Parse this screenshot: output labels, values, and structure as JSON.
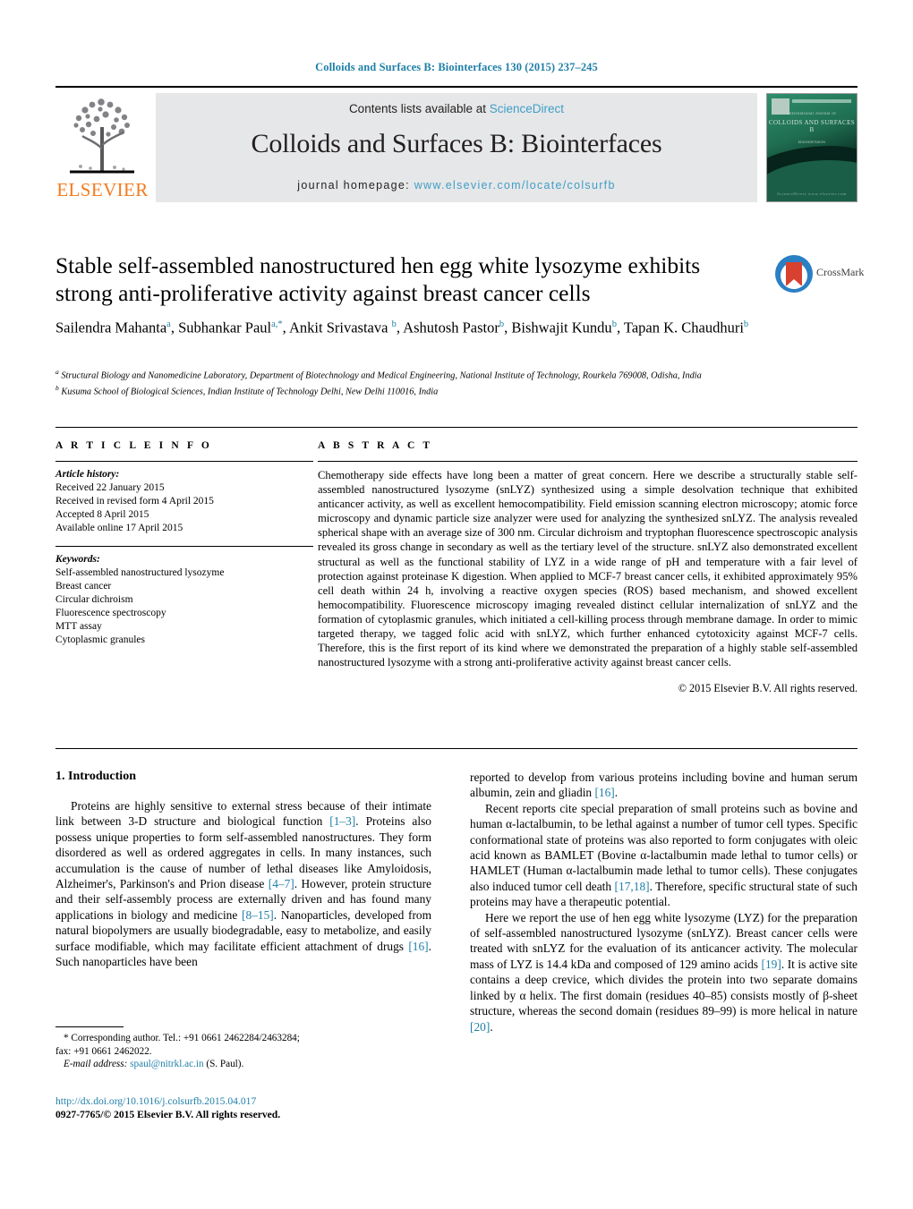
{
  "running_head": "Colloids and Surfaces B: Biointerfaces 130 (2015) 237–245",
  "masthead": {
    "contents_prefix": "Contents lists available at ",
    "contents_link": "ScienceDirect",
    "journal_name": "Colloids and Surfaces B: Biointerfaces",
    "homepage_prefix": "journal homepage: ",
    "homepage_url": "www.elsevier.com/locate/colsurfb",
    "publisher": "ELSEVIER",
    "cover": {
      "title": "COLLOIDS AND SURFACES B",
      "kicker": "International Journal of",
      "subtitle": "Biointerfaces",
      "footer": "ScienceDirect  www.elsevier.com"
    }
  },
  "article": {
    "title": "Stable self-assembled nanostructured hen egg white lysozyme exhibits strong anti-proliferative activity against breast cancer cells",
    "crossmark_label": "CrossMark",
    "authors_line1": "Sailendra Mahanta",
    "authors_html": "Sailendra Mahanta<sup>a</sup>, Subhankar Paul<sup>a,*</sup>, Ankit Srivastava <sup>b</sup>, Ashutosh Pastor<sup>b</sup>, Bishwajit Kundu<sup>b</sup>, Tapan K. Chaudhuri<sup>b</sup>",
    "affiliations": [
      "a Structural Biology and Nanomedicine Laboratory, Department of Biotechnology and Medical Engineering, National Institute of Technology, Rourkela 769008, Odisha, India",
      "b Kusuma School of Biological Sciences, Indian Institute of Technology Delhi, New Delhi 110016, India"
    ]
  },
  "article_info": {
    "heading": "A R T I C L E  I N F O",
    "history_label": "Article history:",
    "history": [
      "Received 22 January 2015",
      "Received in revised form 4 April 2015",
      "Accepted 8 April 2015",
      "Available online 17 April 2015"
    ],
    "keywords_label": "Keywords:",
    "keywords": [
      "Self-assembled nanostructured lysozyme",
      "Breast cancer",
      "Circular dichroism",
      "Fluorescence spectroscopy",
      "MTT assay",
      "Cytoplasmic granules"
    ]
  },
  "abstract": {
    "heading": "A B S T R A C T",
    "text": "Chemotherapy side effects have long been a matter of great concern. Here we describe a structurally stable self-assembled nanostructured lysozyme (snLYZ) synthesized using a simple desolvation technique that exhibited anticancer activity, as well as excellent hemocompatibility. Field emission scanning electron microscopy; atomic force microscopy and dynamic particle size analyzer were used for analyzing the synthesized snLYZ. The analysis revealed spherical shape with an average size of 300 nm. Circular dichroism and tryptophan fluorescence spectroscopic analysis revealed its gross change in secondary as well as the tertiary level of the structure. snLYZ also demonstrated excellent structural as well as the functional stability of LYZ in a wide range of pH and temperature with a fair level of protection against proteinase K digestion. When applied to MCF-7 breast cancer cells, it exhibited approximately 95% cell death within 24 h, involving a reactive oxygen species (ROS) based mechanism, and showed excellent hemocompatibility. Fluorescence microscopy imaging revealed distinct cellular internalization of snLYZ and the formation of cytoplasmic granules, which initiated a cell-killing process through membrane damage. In order to mimic targeted therapy, we tagged folic acid with snLYZ, which further enhanced cytotoxicity against MCF-7 cells. Therefore, this is the first report of its kind where we demonstrated the preparation of a highly stable self-assembled nanostructured lysozyme with a strong anti-proliferative activity against breast cancer cells.",
    "copyright": "© 2015 Elsevier B.V. All rights reserved."
  },
  "introduction": {
    "heading": "1. Introduction",
    "left_paragraph_html": "Proteins are highly sensitive to external stress because of their intimate link between 3-D structure and biological function <span class=\"ref\">[1–3]</span>. Proteins also possess unique properties to form self-assembled nanostructures. They form disordered as well as ordered aggregates in cells. In many instances, such accumulation is the cause of number of lethal diseases like Amyloidosis, Alzheimer's, Parkinson's and Prion disease <span class=\"ref\">[4–7]</span>. However, protein structure and their self-assembly process are externally driven and has found many applications in biology and medicine <span class=\"ref\">[8–15]</span>. Nanoparticles, developed from natural biopolymers are usually biodegradable, easy to metabolize, and easily surface modifiable, which may facilitate efficient attachment of drugs <span class=\"ref\">[16]</span>. Such nanoparticles have been",
    "right_paragraph1_html": "reported to develop from various proteins including bovine and human serum albumin, zein and gliadin <span class=\"ref\">[16]</span>.",
    "right_paragraph2_html": "Recent reports cite special preparation of small proteins such as bovine and human α-lactalbumin, to be lethal against a number of tumor cell types. Specific conformational state of proteins was also reported to form conjugates with oleic acid known as BAMLET (Bovine α-lactalbumin made lethal to tumor cells) or HAMLET (Human α-lactalbumin made lethal to tumor cells). These conjugates also induced tumor cell death <span class=\"ref\">[17,18]</span>. Therefore, specific structural state of such proteins may have a therapeutic potential.",
    "right_paragraph3_html": "Here we report the use of hen egg white lysozyme (LYZ) for the preparation of self-assembled nanostructured lysozyme (snLYZ). Breast cancer cells were treated with snLYZ for the evaluation of its anticancer activity. The molecular mass of LYZ is 14.4 kDa and composed of 129 amino acids <span class=\"ref\">[19]</span>. It is active site contains a deep crevice, which divides the protein into two separate domains linked by α helix. The first domain (residues 40–85) consists mostly of β-sheet structure, whereas the second domain (residues 89–99) is more helical in nature <span class=\"ref\">[20]</span>."
  },
  "footnote": {
    "corresponding": "* Corresponding author. Tel.: +91 0661 2462284/2463284;",
    "fax": "fax: +91 0661 2462022.",
    "email_label": "E-mail address:",
    "email": "spaul@nitrkl.ac.in",
    "email_suffix": "(S. Paul).",
    "doi": "http://dx.doi.org/10.1016/j.colsurfb.2015.04.017",
    "issn_line": "0927-7765/© 2015 Elsevier B.V. All rights reserved."
  },
  "colors": {
    "link_blue": "#1f7fa8",
    "elsevier_orange": "#F47B20",
    "band_gray": "#e6e7e8"
  }
}
